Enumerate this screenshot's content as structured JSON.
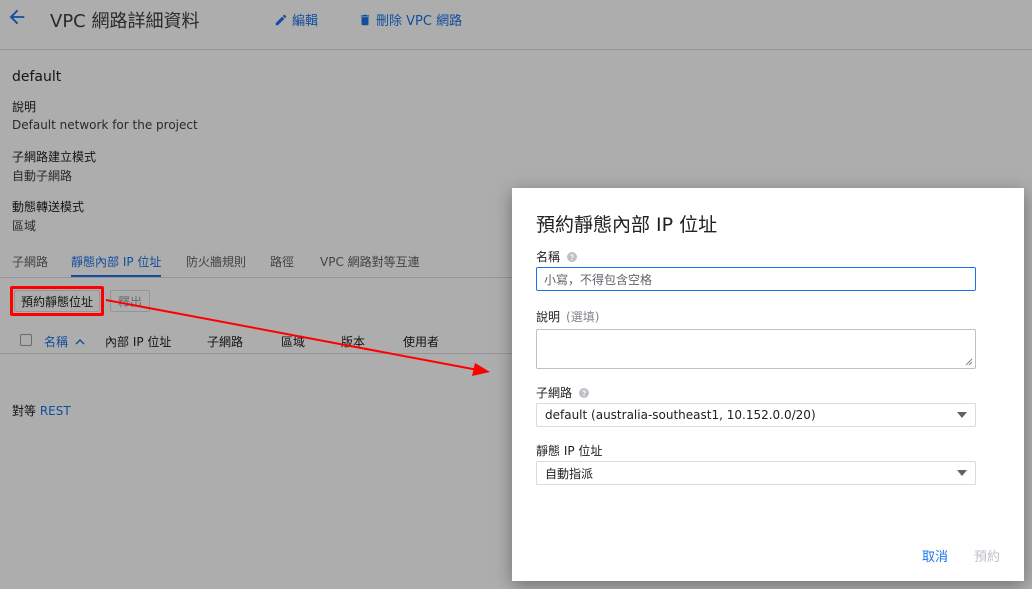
{
  "header": {
    "title": "VPC 網路詳細資料",
    "edit_label": "編輯",
    "delete_label": "刪除 VPC 網路",
    "back_icon": "arrow-back-icon",
    "edit_icon": "pencil-icon",
    "delete_icon": "trash-icon"
  },
  "network": {
    "name": "default",
    "description_label": "說明",
    "description_value": "Default network for the project",
    "subnet_mode_label": "子網路建立模式",
    "subnet_mode_value": "自動子網路",
    "routing_mode_label": "動態轉送模式",
    "routing_mode_value": "區域"
  },
  "tabs": [
    {
      "label": "子網路",
      "active": false
    },
    {
      "label": "靜態內部 IP 位址",
      "active": true
    },
    {
      "label": "防火牆規則",
      "active": false
    },
    {
      "label": "路徑",
      "active": false
    },
    {
      "label": "VPC 網路對等互連",
      "active": false
    }
  ],
  "toolbar": {
    "reserve_label": "預約靜態位址",
    "release_label": "釋出"
  },
  "table": {
    "columns": [
      "名稱",
      "內部 IP 位址",
      "子網路",
      "區域",
      "版本",
      "使用者"
    ],
    "sort_icon": "sort-ascending-icon"
  },
  "footer": {
    "prefix": "對等",
    "link": "REST"
  },
  "dialog": {
    "title": "預約靜態內部 IP 位址",
    "name_label": "名稱",
    "name_placeholder": "小寫，不得包含空格",
    "description_label": "說明",
    "description_optional": "(選填)",
    "subnet_label": "子網路",
    "subnet_value": "default (australia-southeast1, 10.152.0.0/20)",
    "static_ip_label": "靜態 IP 位址",
    "static_ip_value": "自動指派",
    "cancel_label": "取消",
    "reserve_label": "預約",
    "help_icon": "help-circle-icon",
    "dropdown_icon": "caret-down-icon"
  },
  "colors": {
    "accent": "#1a73e8",
    "annotation": "#ff0000",
    "scrim": "#000000"
  }
}
